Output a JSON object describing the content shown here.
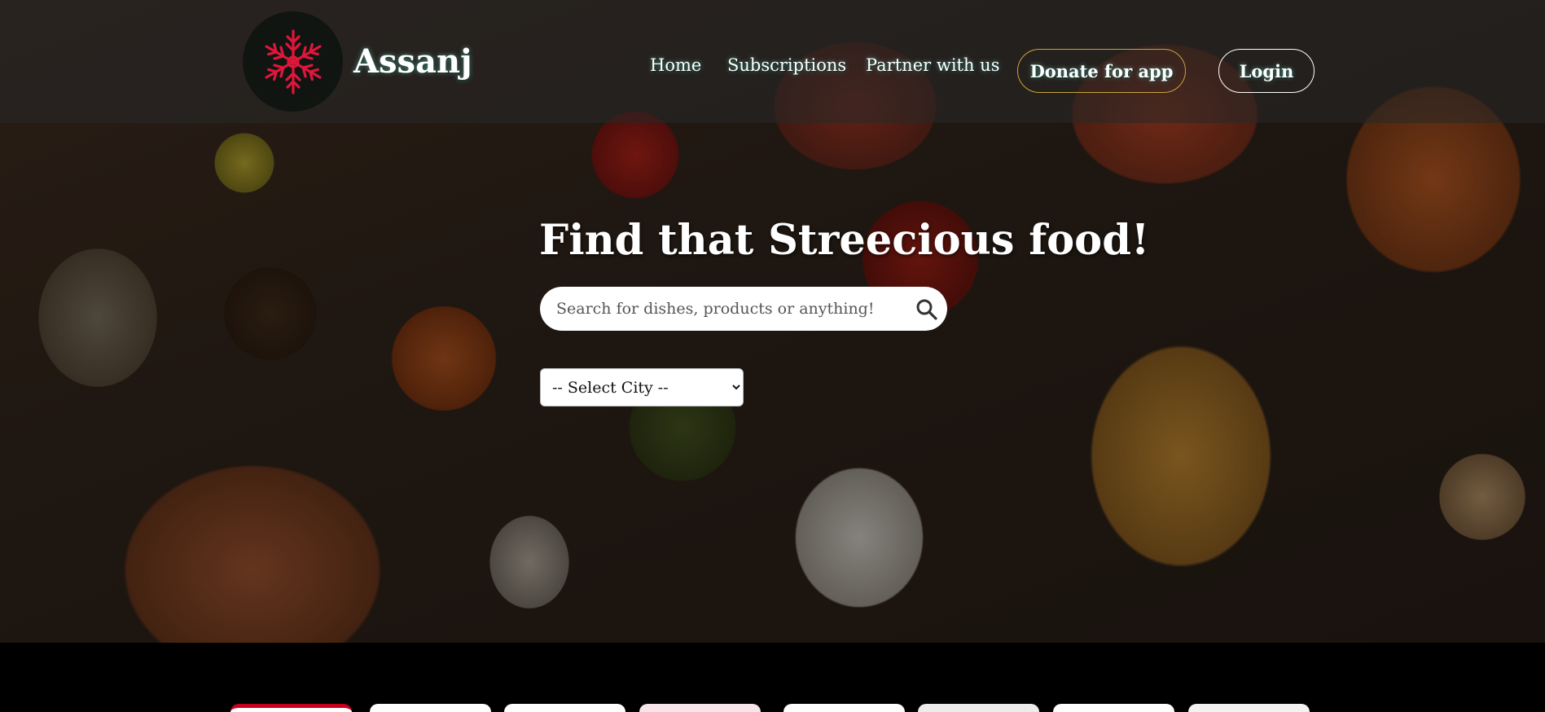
{
  "header": {
    "brand": "Assanj",
    "logo_icon": "snowflake-icon",
    "nav": [
      {
        "label": "Home"
      },
      {
        "label": "Subscriptions"
      },
      {
        "label": "Partner with us"
      }
    ],
    "donate_label": "Donate for app",
    "login_label": "Login"
  },
  "hero": {
    "headline": "Find that Streecious food!",
    "search": {
      "placeholder": "Search for dishes, products or anything!",
      "value": "",
      "icon": "search-icon"
    },
    "city_select": {
      "selected": "-- Select City --",
      "options": [
        "-- Select City --"
      ]
    }
  },
  "colors": {
    "accent_red": "#e0163a",
    "donate_border": "#c9a33a",
    "login_border": "#ffffff",
    "header_overlay": "#282828",
    "footer": "#000000"
  }
}
